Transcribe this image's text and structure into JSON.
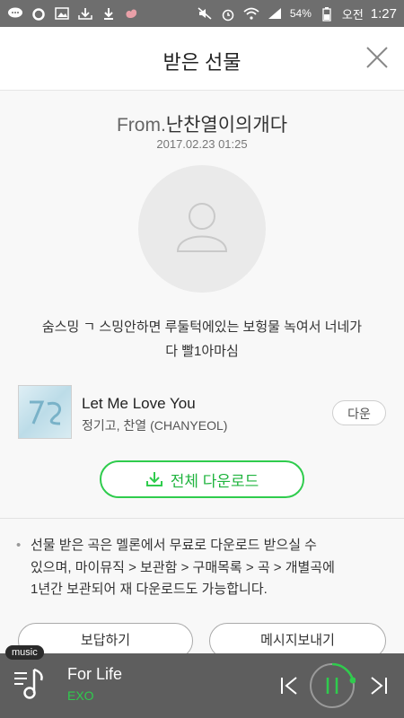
{
  "status_bar": {
    "battery": "54%",
    "ampm": "오전",
    "time": "1:27"
  },
  "header": {
    "title": "받은 선물",
    "close_icon": "close-icon"
  },
  "gift": {
    "from_prefix": "From.",
    "from_name": "난찬열이의개다",
    "date": "2017.02.23 01:25",
    "message_line1": "숨스밍 ㄱ 스밍안하면 루둘턱에있는 보헝물 녹여서 너네가",
    "message_line2": "다 빨1아마심"
  },
  "song": {
    "title": "Let Me Love You",
    "artist": "정기고, 찬열 (CHANYEOL)",
    "download_label": "다운"
  },
  "all_download_label": "전체 다운로드",
  "notice": {
    "line1": "선물 받은 곡은 멜론에서 무료로 다운로드 받으실 수",
    "line2": "있으며, 마이뮤직 > 보관함 > 구매목록 > 곡 > 개별곡에",
    "line3": "1년간 보관되어 재 다운로드도 가능합니다."
  },
  "buttons": {
    "reply": "보답하기",
    "send_message": "메시지보내기"
  },
  "player": {
    "badge": "music",
    "title": "For Life",
    "artist": "EXO",
    "accent": "#2fcc4d"
  }
}
